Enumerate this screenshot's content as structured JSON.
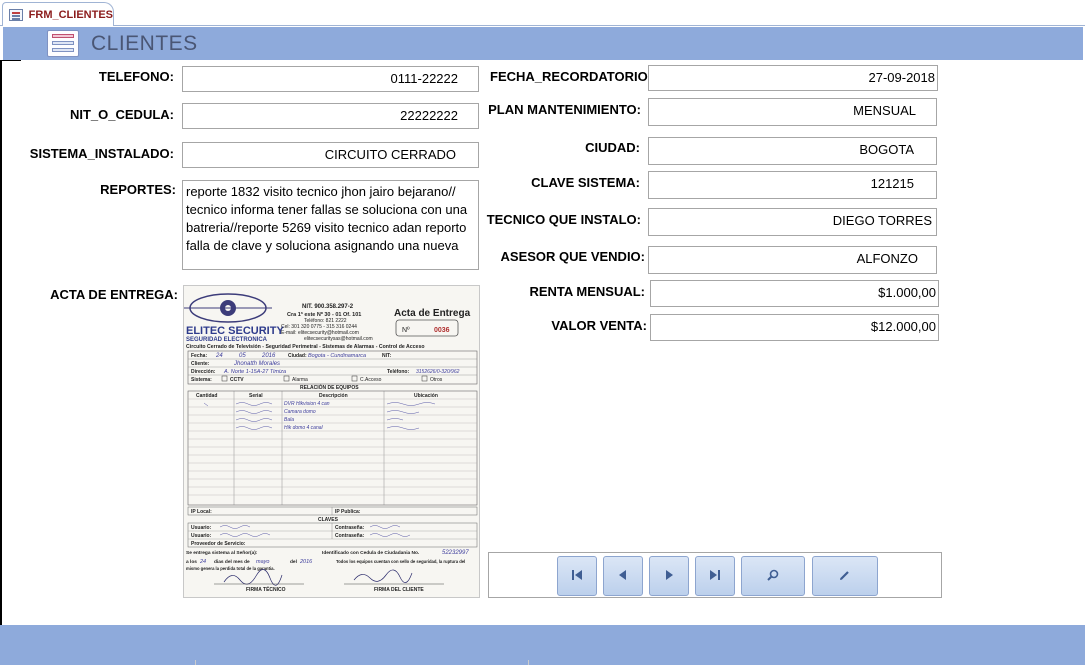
{
  "tab": {
    "label": "FRM_CLIENTES"
  },
  "header": {
    "title": "CLIENTES"
  },
  "fields": {
    "telefono": {
      "label": "TELEFONO:",
      "value": "0111-22222"
    },
    "nit": {
      "label": "NIT_O_CEDULA:",
      "value": "22222222"
    },
    "sistema": {
      "label": "SISTEMA_INSTALADO:",
      "value": "CIRCUITO CERRADO"
    },
    "reportes": {
      "label": "REPORTES:",
      "value": "reporte 1832 visito tecnico jhon jairo bejarano// tecnico informa tener fallas se soluciona con una batreria//reporte 5269 visito tecnico adan  reporto falla de clave y soluciona asignando una nueva"
    },
    "acta": {
      "label": "ACTA DE ENTREGA:"
    },
    "fecha_recordatorio": {
      "label": "FECHA_RECORDATORIO:",
      "value": "27-09-2018"
    },
    "plan": {
      "label": "PLAN MANTENIMIENTO:",
      "value": "MENSUAL"
    },
    "ciudad": {
      "label": "CIUDAD:",
      "value": "BOGOTA"
    },
    "clave": {
      "label": "CLAVE SISTEMA:",
      "value": "121215"
    },
    "tecnico": {
      "label": "TECNICO QUE INSTALO:",
      "value": "DIEGO TORRES"
    },
    "asesor": {
      "label": "ASESOR QUE VENDIO:",
      "value": "ALFONZO"
    },
    "renta": {
      "label": "RENTA MENSUAL:",
      "value": "$1.000,00"
    },
    "venta": {
      "label": "VALOR VENTA:",
      "value": "$12.000,00"
    }
  },
  "document": {
    "company": "ELITEC SECURITY",
    "subtitle": "SEGURIDAD ELECTRONICA",
    "nit": "NIT. 900.358.297-2",
    "address": "Cra 1ª este Nº 30 - 01 Of. 101",
    "phone": "Teléfono: 821 2222",
    "cel": "Cel: 301 320 0775 - 315 316 0244",
    "email": "E-mail: elitecsecurity@hotmail.com",
    "email2": "elitecsecuritysas@hotmail.com",
    "doc_title": "Acta de Entrega",
    "doc_number_label": "Nº",
    "doc_number": "0036",
    "services": "Circuito Cerrado de Televisión - Seguridad Perimetral - Sistemas de Alarmas - Control de Acceso",
    "fecha_label": "Fecha:",
    "fecha_day": "24",
    "fecha_month": "05",
    "fecha_year": "2016",
    "ciudad_label": "Ciudad:",
    "ciudad_value": "Bogota - Cundinamarca",
    "nit_label": "NIT:",
    "cliente_label": "Cliente:",
    "cliente_value": "Jhonatth Morales",
    "direccion_label": "Dirección:",
    "direccion_value": "A. Norte 1-15A-27 Timiza",
    "telefono_label": "Teléfono:",
    "telefono_value": "3152626/0-320/962",
    "sistema_label": "Sistema:",
    "cctv": "CCTV",
    "alarma": "Alarma",
    "c_acceso": "C.Acceso",
    "otros": "Otros",
    "relacion": "RELACIÓN DE EQUIPOS",
    "col_cantidad": "Cantidad",
    "col_serial": "Serial",
    "col_descripcion": "Descripción",
    "col_ubicacion": "Ubicación",
    "hw1": "DVR Hikvision 4 can",
    "hw2": "Camara domo",
    "hw3": "Bala",
    "hw4": "Hik domo 4 canal",
    "ip_local": "IP Local:",
    "ip_publica": "IP Publica:",
    "claves": "CLAVES",
    "usuario_label": "Usuario:",
    "contrasena_label": "Contraseña:",
    "proveedor": "Proveedor de Servicio:",
    "entrega": "Se entrega sistema al Señor(a):",
    "identificado": "Identificado con Cedula de Ciudadania No.",
    "cedula": "52232997",
    "dias": "a los",
    "dia_value": "24",
    "mes_label": "dias del mes de",
    "mes_value": "mayo",
    "del_label": "del",
    "year_value": "2016",
    "todos": "Todos los equipos cuentan con sello de seguridad, la ruptura del",
    "perdida": "mismo genera la perdida total de la garantia.",
    "firma_tecnico": "FIRMA TÉCNICO",
    "firma_cliente": "FIRMA DEL CLIENTE"
  },
  "nav": {
    "first": "first-record",
    "prev": "previous-record",
    "next": "next-record",
    "last": "last-record",
    "search": "search",
    "edit": "edit"
  }
}
